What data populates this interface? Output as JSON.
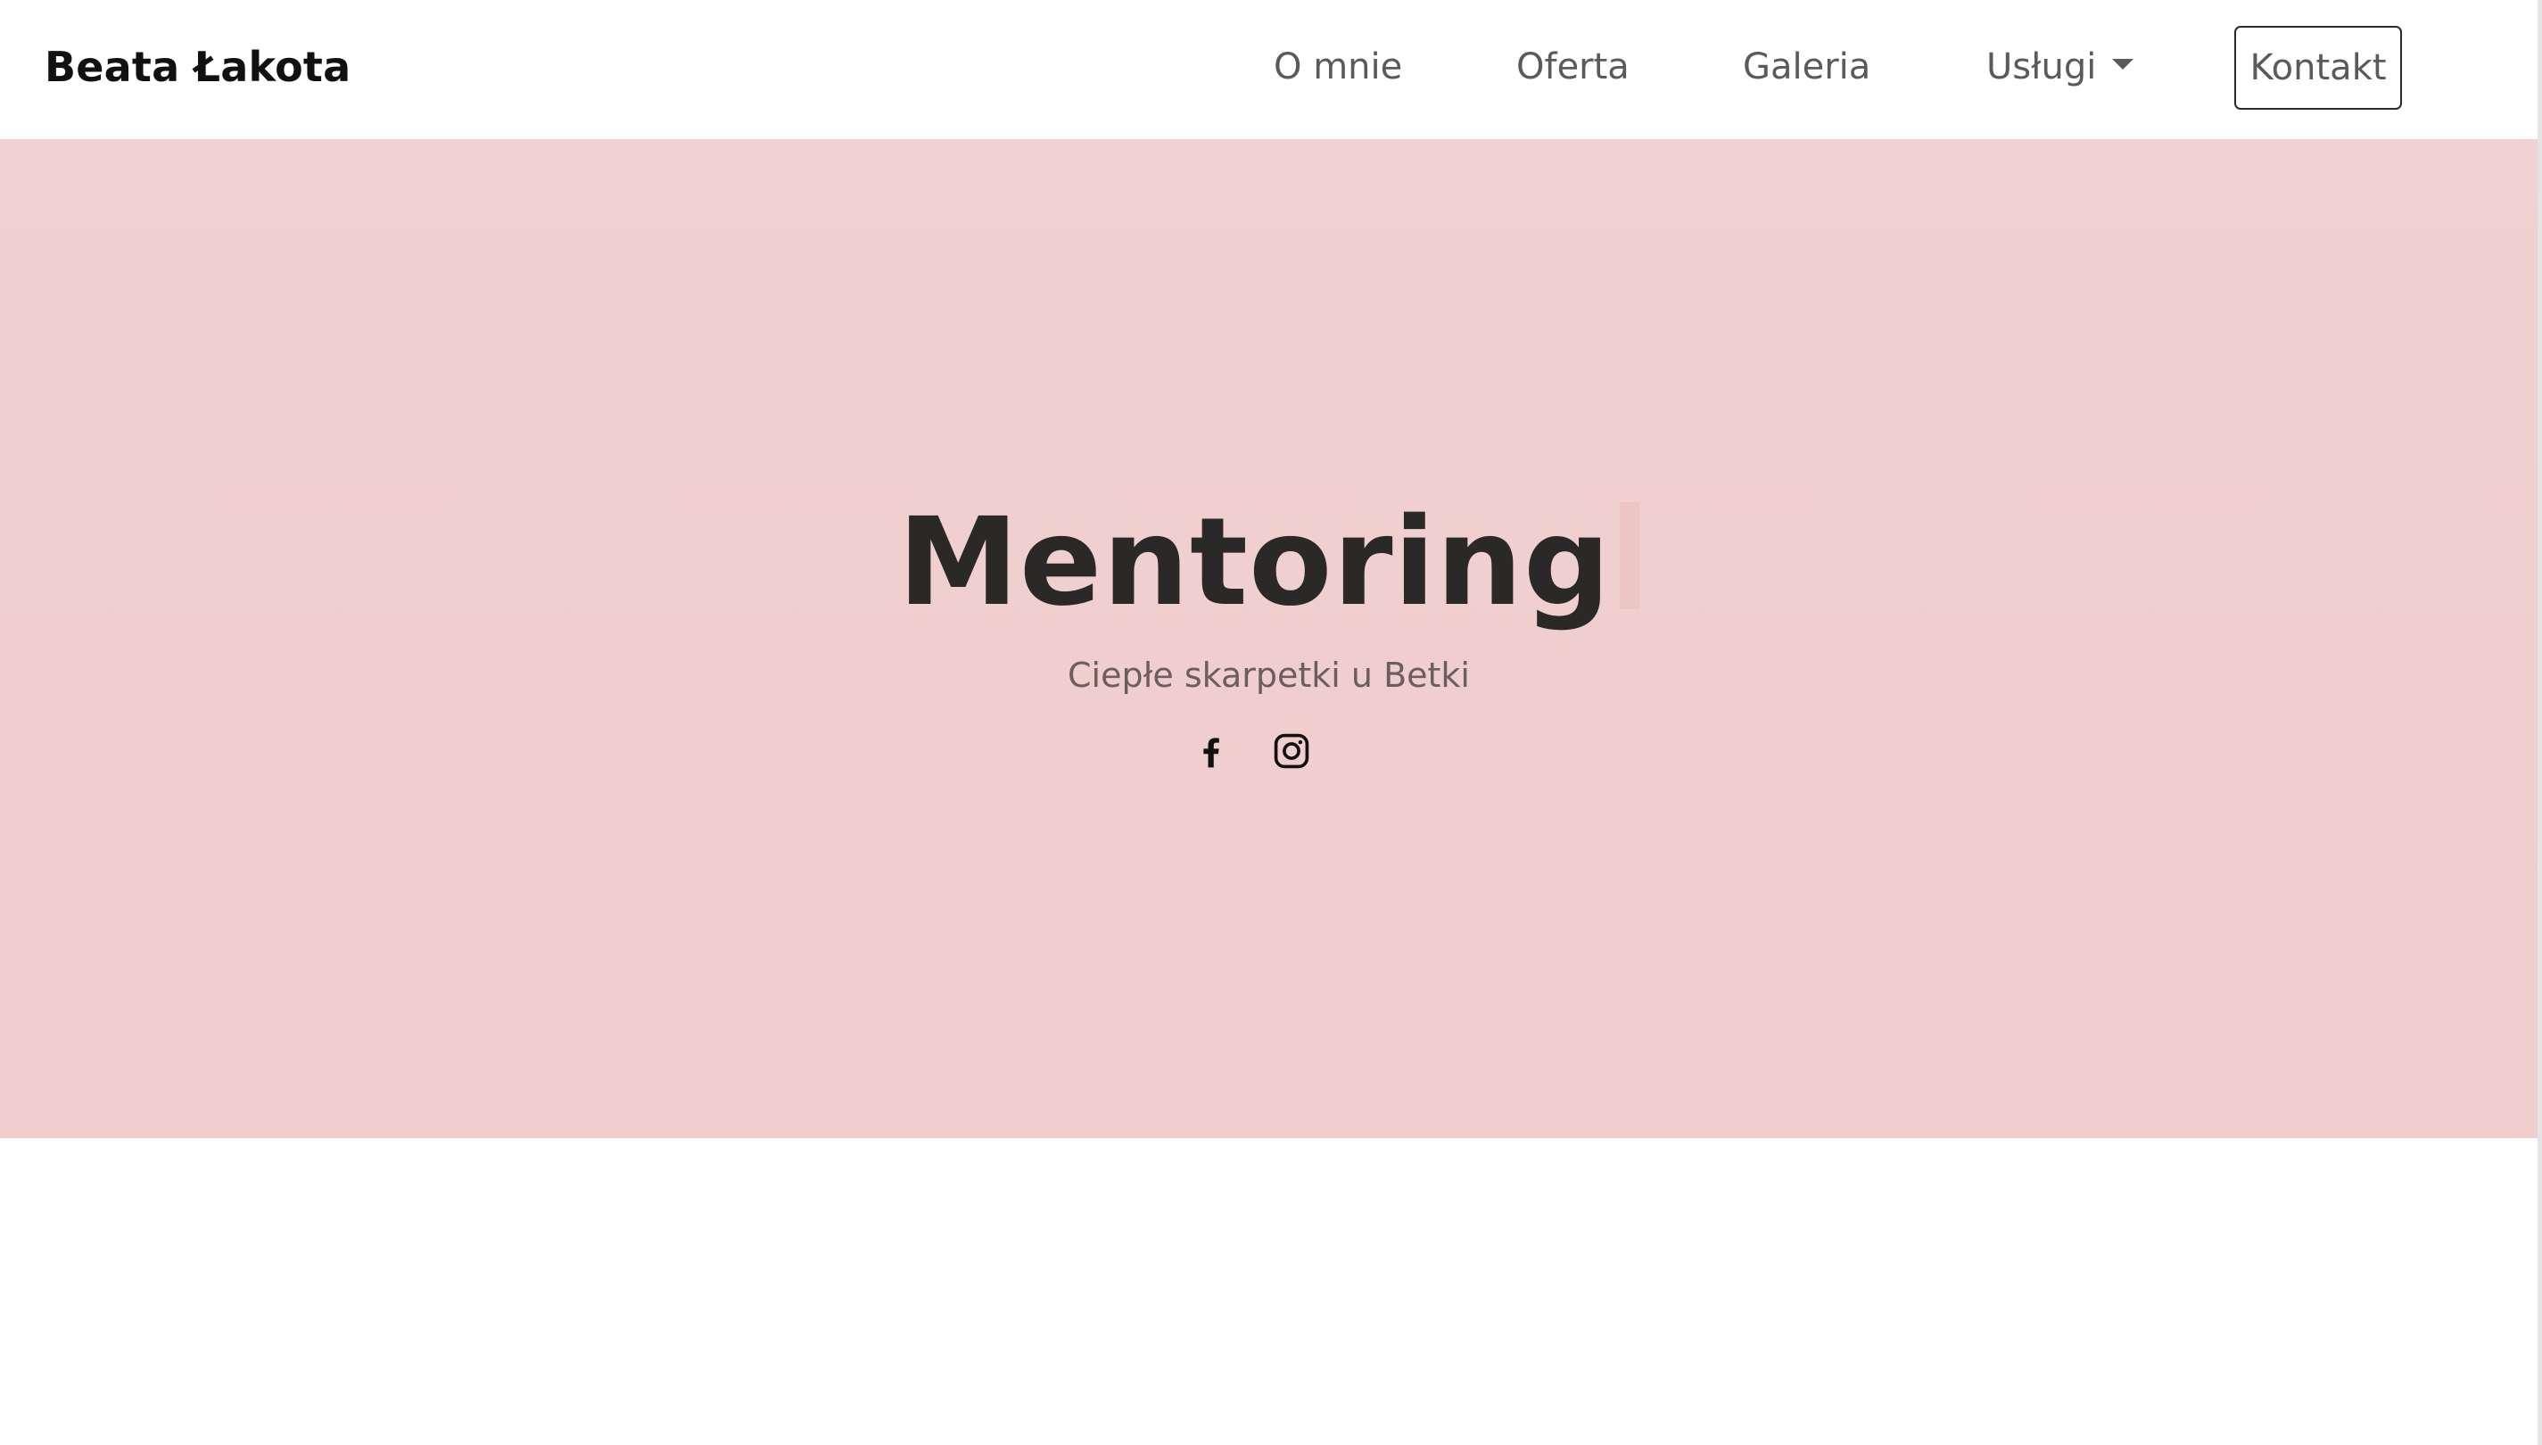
{
  "navbar": {
    "brand": "Beata Łakota",
    "links": [
      {
        "label": "O mnie"
      },
      {
        "label": "Oferta"
      },
      {
        "label": "Galeria"
      },
      {
        "label": "Usługi"
      }
    ],
    "contact_label": "Kontakt",
    "dropdown_icon": "chevron-down-icon"
  },
  "hero": {
    "title": "Mentoring",
    "subtitle": "Ciepłe skarpetki u Betki",
    "background_color": "#f1cfcf",
    "social": [
      {
        "icon": "facebook-icon"
      },
      {
        "icon": "instagram-icon"
      }
    ]
  }
}
